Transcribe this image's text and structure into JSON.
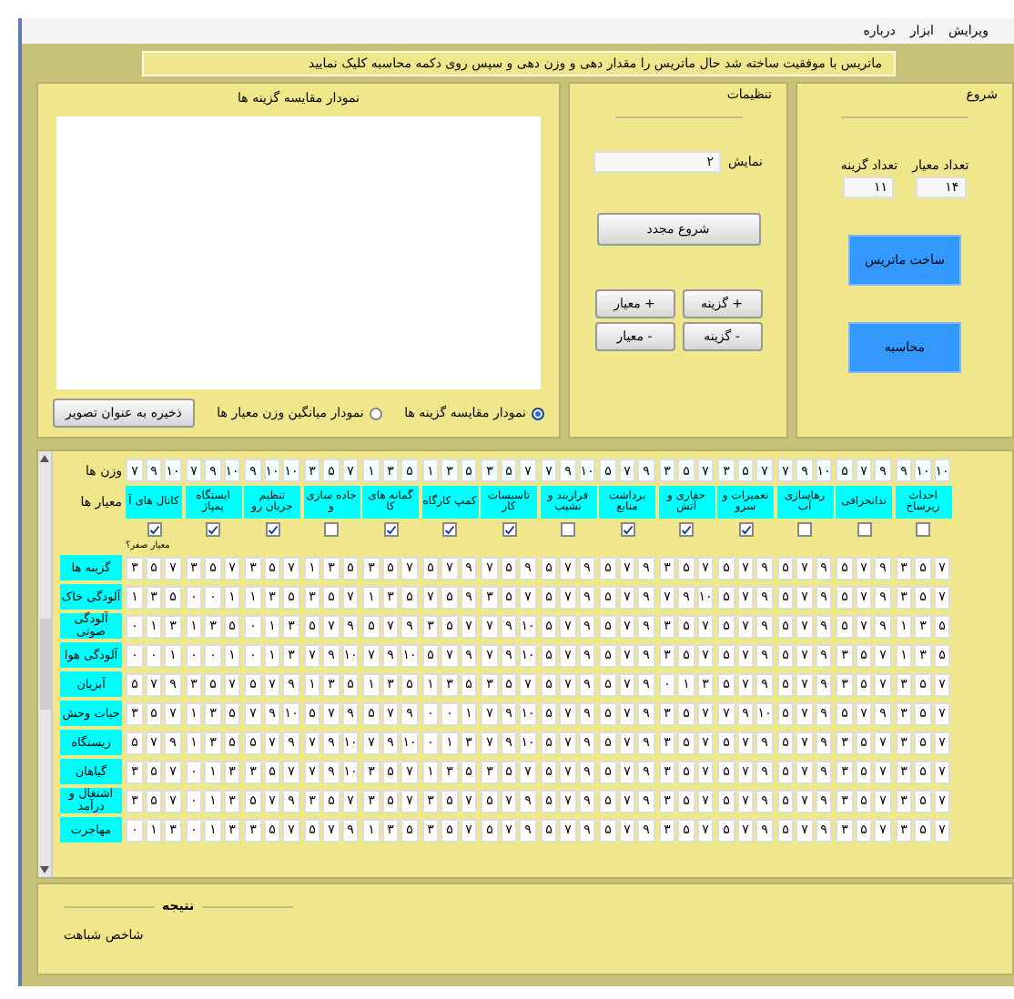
{
  "menu": [
    {
      "label": "ویرایش"
    },
    {
      "label": "ابزار"
    },
    {
      "label": "درباره"
    }
  ],
  "message": "ماتریس با موفقیت ساخته شد حال ماتریس را مقدار دهی و وزن دهی و سپس روی دکمه محاسبه کلیک نمایید",
  "start_panel": {
    "title": "شروع",
    "criteria_count": {
      "label": "تعداد معیار",
      "value": "۱۴"
    },
    "alternatives_count": {
      "label": "تعداد گزینه",
      "value": "۱۱"
    },
    "buttons": [
      "ساخت ماتریس",
      "محاسبه"
    ]
  },
  "settings_panel": {
    "title": "تنظیمات",
    "display": {
      "label": "نمایش",
      "value": "۲"
    },
    "restart": "شروع مجدد",
    "buttons": [
      "+ گزینه",
      "+ معیار",
      "- گزینه",
      "- معیار"
    ]
  },
  "chart_panel": {
    "title": "نمودار مقایسه گزینه ها",
    "options": [
      {
        "label": "نمودار مقایسه گزینه ها",
        "selected": true
      },
      {
        "label": "نمودار میانگین وزن معیار ها",
        "selected": false
      }
    ],
    "save": "ذخیره به عنوان تصویر"
  },
  "matrix": {
    "weights_label": "وزن ها",
    "criteria_label": "معیار ها",
    "zero_hint": "معیار صفر؟",
    "criteria": [
      {
        "name": "احداث زیرساخ",
        "weights": [
          "۱۰",
          "۱۰",
          "۹"
        ],
        "checked": false
      },
      {
        "name": "ندانحرافی",
        "weights": [
          "۹",
          "۷",
          "۵"
        ],
        "checked": false
      },
      {
        "name": "رهاسازی آب",
        "weights": [
          "۱۰",
          "۹",
          "۷"
        ],
        "checked": false
      },
      {
        "name": "تعمیرات و سرو",
        "weights": [
          "۷",
          "۵",
          "۳"
        ],
        "checked": true
      },
      {
        "name": "حفاری و آتش",
        "weights": [
          "۷",
          "۵",
          "۳"
        ],
        "checked": true
      },
      {
        "name": "برداشت منابع",
        "weights": [
          "۹",
          "۷",
          "۵"
        ],
        "checked": true
      },
      {
        "name": "فرازبند و نشیب",
        "weights": [
          "۱۰",
          "۹",
          "۷"
        ],
        "checked": false
      },
      {
        "name": "تاسیسات کار",
        "weights": [
          "۷",
          "۵",
          "۳"
        ],
        "checked": true
      },
      {
        "name": "کمپ کارگاه",
        "weights": [
          "۵",
          "۳",
          "۱"
        ],
        "checked": true
      },
      {
        "name": "گمانه های کا",
        "weights": [
          "۵",
          "۳",
          "۱"
        ],
        "checked": true
      },
      {
        "name": "جاده سازی و",
        "weights": [
          "۷",
          "۵",
          "۳"
        ],
        "checked": false
      },
      {
        "name": "تنظیم جریان رو",
        "weights": [
          "۱۰",
          "۱۰",
          "۹"
        ],
        "checked": true
      },
      {
        "name": "ایستگاه پمپاژ",
        "weights": [
          "۱۰",
          "۹",
          "۷"
        ],
        "checked": true
      },
      {
        "name": "کانال های آ",
        "weights": [
          "۱۰",
          "۹",
          "۷"
        ],
        "checked": true
      }
    ],
    "rows": [
      {
        "label": "گزینه ها",
        "values": [
          [
            "۷",
            "۵",
            "۳"
          ],
          [
            "۹",
            "۷",
            "۵"
          ],
          [
            "۹",
            "۷",
            "۵"
          ],
          [
            "۹",
            "۷",
            "۵"
          ],
          [
            "۷",
            "۵",
            "۳"
          ],
          [
            "۹",
            "۷",
            "۵"
          ],
          [
            "۹",
            "۷",
            "۵"
          ],
          [
            "۹",
            "۵",
            "۷"
          ],
          [
            "۹",
            "۷",
            "۵"
          ],
          [
            "۷",
            "۵",
            "۳"
          ],
          [
            "۵",
            "۳",
            "۱"
          ],
          [
            "۷",
            "۵",
            "۳"
          ],
          [
            "۷",
            "۵",
            "۳"
          ],
          [
            "۷",
            "۵",
            "۳"
          ]
        ]
      },
      {
        "label": "آلودگی خاک",
        "values": [
          [
            "۷",
            "۵",
            "۳"
          ],
          [
            "۹",
            "۷",
            "۵"
          ],
          [
            "۹",
            "۷",
            "۵"
          ],
          [
            "۹",
            "۷",
            "۵"
          ],
          [
            "۱۰",
            "۹",
            "۷"
          ],
          [
            "۹",
            "۷",
            "۵"
          ],
          [
            "۹",
            "۷",
            "۵"
          ],
          [
            "۷",
            "۵",
            "۳"
          ],
          [
            "۹",
            "۵",
            "۷"
          ],
          [
            "۵",
            "۳",
            "۱"
          ],
          [
            "۷",
            "۵",
            "۳"
          ],
          [
            "۵",
            "۳",
            "۱"
          ],
          [
            "۱",
            "۰",
            "۰"
          ],
          [
            "۵",
            "۳",
            "۱"
          ]
        ]
      },
      {
        "label": "آلودگی صوتی",
        "values": [
          [
            "۵",
            "۳",
            "۱"
          ],
          [
            "۹",
            "۷",
            "۵"
          ],
          [
            "۹",
            "۷",
            "۵"
          ],
          [
            "۹",
            "۷",
            "۵"
          ],
          [
            "۷",
            "۵",
            "۳"
          ],
          [
            "۹",
            "۷",
            "۵"
          ],
          [
            "۹",
            "۷",
            "۵"
          ],
          [
            "۱۰",
            "۹",
            "۷"
          ],
          [
            "۷",
            "۵",
            "۳"
          ],
          [
            "۹",
            "۷",
            "۵"
          ],
          [
            "۹",
            "۷",
            "۵"
          ],
          [
            "۳",
            "۱",
            "۰"
          ],
          [
            "۵",
            "۳",
            "۱"
          ],
          [
            "۳",
            "۱",
            "۰"
          ]
        ]
      },
      {
        "label": "آلودگی هوا",
        "values": [
          [
            "۵",
            "۳",
            "۱"
          ],
          [
            "۷",
            "۵",
            "۳"
          ],
          [
            "۹",
            "۷",
            "۵"
          ],
          [
            "۹",
            "۷",
            "۵"
          ],
          [
            "۷",
            "۵",
            "۳"
          ],
          [
            "۹",
            "۷",
            "۵"
          ],
          [
            "۹",
            "۷",
            "۵"
          ],
          [
            "۱۰",
            "۹",
            "۷"
          ],
          [
            "۹",
            "۷",
            "۵"
          ],
          [
            "۱۰",
            "۹",
            "۷"
          ],
          [
            "۱۰",
            "۹",
            "۷"
          ],
          [
            "۳",
            "۱",
            "۰"
          ],
          [
            "۱",
            "۰",
            "۰"
          ],
          [
            "۱",
            "۰",
            "۰"
          ]
        ]
      },
      {
        "label": "آبزیان",
        "values": [
          [
            "۷",
            "۵",
            "۳"
          ],
          [
            "۷",
            "۵",
            "۳"
          ],
          [
            "۹",
            "۷",
            "۵"
          ],
          [
            "۹",
            "۷",
            "۵"
          ],
          [
            "۳",
            "۱",
            "۰"
          ],
          [
            "۹",
            "۷",
            "۵"
          ],
          [
            "۹",
            "۷",
            "۵"
          ],
          [
            "۷",
            "۵",
            "۳"
          ],
          [
            "۵",
            "۳",
            "۱"
          ],
          [
            "۵",
            "۳",
            "۱"
          ],
          [
            "۵",
            "۳",
            "۱"
          ],
          [
            "۹",
            "۷",
            "۵"
          ],
          [
            "۷",
            "۵",
            "۳"
          ],
          [
            "۹",
            "۷",
            "۵"
          ]
        ]
      },
      {
        "label": "حیات وحش",
        "values": [
          [
            "۷",
            "۵",
            "۳"
          ],
          [
            "۹",
            "۷",
            "۵"
          ],
          [
            "۹",
            "۷",
            "۵"
          ],
          [
            "۱۰",
            "۹",
            "۷"
          ],
          [
            "۷",
            "۵",
            "۳"
          ],
          [
            "۹",
            "۷",
            "۵"
          ],
          [
            "۹",
            "۷",
            "۵"
          ],
          [
            "۱۰",
            "۹",
            "۷"
          ],
          [
            "۱",
            "۰",
            "۰"
          ],
          [
            "۹",
            "۷",
            "۵"
          ],
          [
            "۹",
            "۷",
            "۵"
          ],
          [
            "۱۰",
            "۹",
            "۷"
          ],
          [
            "۵",
            "۳",
            "۱"
          ],
          [
            "۷",
            "۵",
            "۳"
          ]
        ]
      },
      {
        "label": "زیستگاه",
        "values": [
          [
            "۷",
            "۵",
            "۳"
          ],
          [
            "۷",
            "۵",
            "۳"
          ],
          [
            "۹",
            "۷",
            "۵"
          ],
          [
            "۹",
            "۷",
            "۵"
          ],
          [
            "۷",
            "۵",
            "۳"
          ],
          [
            "۹",
            "۷",
            "۵"
          ],
          [
            "۹",
            "۷",
            "۵"
          ],
          [
            "۱۰",
            "۹",
            "۷"
          ],
          [
            "۳",
            "۱",
            "۰"
          ],
          [
            "۱۰",
            "۹",
            "۷"
          ],
          [
            "۱۰",
            "۹",
            "۷"
          ],
          [
            "۹",
            "۷",
            "۵"
          ],
          [
            "۵",
            "۳",
            "۱"
          ],
          [
            "۹",
            "۷",
            "۵"
          ]
        ]
      },
      {
        "label": "گیاهان",
        "values": [
          [
            "۷",
            "۵",
            "۳"
          ],
          [
            "۷",
            "۵",
            "۳"
          ],
          [
            "۹",
            "۷",
            "۵"
          ],
          [
            "۹",
            "۷",
            "۵"
          ],
          [
            "۷",
            "۵",
            "۳"
          ],
          [
            "۹",
            "۷",
            "۵"
          ],
          [
            "۹",
            "۷",
            "۵"
          ],
          [
            "۷",
            "۵",
            "۳"
          ],
          [
            "۵",
            "۳",
            "۱"
          ],
          [
            "۷",
            "۵",
            "۳"
          ],
          [
            "۱۰",
            "۹",
            "۷"
          ],
          [
            "۷",
            "۵",
            "۳"
          ],
          [
            "۳",
            "۱",
            "۰"
          ],
          [
            "۷",
            "۵",
            "۳"
          ]
        ]
      },
      {
        "label": "اشتغال و درآمد",
        "values": [
          [
            "۷",
            "۵",
            "۳"
          ],
          [
            "۷",
            "۵",
            "۳"
          ],
          [
            "۹",
            "۷",
            "۵"
          ],
          [
            "۹",
            "۷",
            "۵"
          ],
          [
            "۷",
            "۵",
            "۳"
          ],
          [
            "۹",
            "۷",
            "۵"
          ],
          [
            "۹",
            "۷",
            "۵"
          ],
          [
            "۹",
            "۷",
            "۵"
          ],
          [
            "۷",
            "۵",
            "۳"
          ],
          [
            "۷",
            "۵",
            "۳"
          ],
          [
            "۷",
            "۵",
            "۳"
          ],
          [
            "۹",
            "۷",
            "۵"
          ],
          [
            "۳",
            "۱",
            "۰"
          ],
          [
            "۷",
            "۵",
            "۳"
          ]
        ]
      },
      {
        "label": "مهاجرت",
        "values": [
          [
            "۷",
            "۵",
            "۳"
          ],
          [
            "۷",
            "۵",
            "۳"
          ],
          [
            "۹",
            "۷",
            "۵"
          ],
          [
            "۹",
            "۷",
            "۵"
          ],
          [
            "۷",
            "۵",
            "۳"
          ],
          [
            "۹",
            "۷",
            "۵"
          ],
          [
            "۹",
            "۷",
            "۵"
          ],
          [
            "۹",
            "۷",
            "۵"
          ],
          [
            "۷",
            "۵",
            "۳"
          ],
          [
            "۵",
            "۳",
            "۱"
          ],
          [
            "۹",
            "۷",
            "۵"
          ],
          [
            "۷",
            "۵",
            "۳"
          ],
          [
            "۳",
            "۱",
            "۰"
          ],
          [
            "۳",
            "۱",
            "۰"
          ]
        ]
      }
    ]
  },
  "result": {
    "title": "نتیجه",
    "index_label": "شاخص شباهت"
  }
}
